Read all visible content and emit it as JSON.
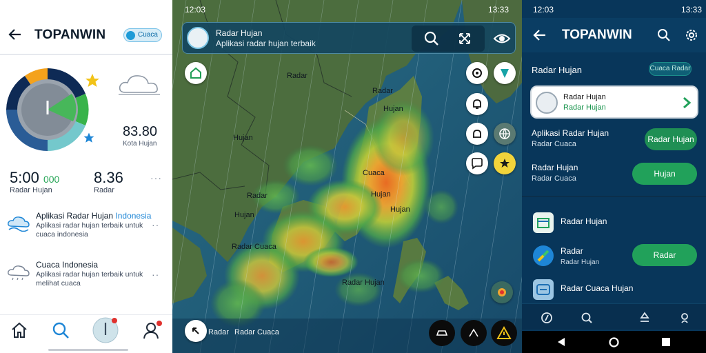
{
  "panel_left": {
    "app_title": "TOPANWIN",
    "chip_label": "Cuaca",
    "big_value": "83.80",
    "big_caption": "Kota Hujan",
    "stat1": {
      "value": "5:00",
      "accent": "000",
      "label": "Radar Hujan"
    },
    "stat2": {
      "value": "8.36",
      "label": "Radar"
    },
    "list": [
      {
        "title": "Aplikasi Radar Hujan",
        "title_accent": "Indonesia",
        "desc": "Aplikasi radar hujan terbaik untuk cuaca indonesia"
      },
      {
        "title": "Cuaca Indonesia",
        "title_accent": "",
        "desc": "Aplikasi radar hujan terbaik untuk melihat cuaca"
      }
    ],
    "icons": [
      "back-arrow-icon",
      "gauge-icon",
      "star-icon",
      "cloud-icon",
      "home-icon",
      "search-icon",
      "compass-icon",
      "profile-icon"
    ]
  },
  "panel_map": {
    "status_time": "12:03",
    "status_right": "13:33",
    "search_title": "Radar Hujan",
    "search_subtitle": "Aplikasi radar hujan terbaik",
    "labels": [
      "Radar",
      "Radar",
      "Hujan",
      "Hujan",
      "Cuaca",
      "Radar",
      "Hujan",
      "Hujan",
      "Hujan",
      "Radar Cuaca",
      "Radar Hujan",
      "Radar",
      "Radar Cuaca"
    ],
    "rain_legend": [
      "heavy-rain",
      "moderate-rain",
      "light-rain"
    ],
    "icons": [
      "avatar-icon",
      "search-icon",
      "expand-icon",
      "eye-icon",
      "map-pin-icon",
      "navigation-icon",
      "layers-icon",
      "bell-icon",
      "alarm-icon",
      "chat-icon",
      "globe-icon",
      "star-badge-icon",
      "location-icon",
      "back-icon"
    ]
  },
  "panel_right": {
    "status_time": "12:03",
    "status_right": "13:33",
    "app_title": "TOPANWIN",
    "section_title": "Radar Hujan",
    "section_pill": "Cuaca Radar",
    "card_title": "Radar Hujan",
    "card_subtitle": "Radar Hujan",
    "rows": [
      {
        "title": "Aplikasi Radar Hujan",
        "subtitle": "Radar Cuaca",
        "button": "Radar Hujan"
      },
      {
        "title": "Radar Hujan",
        "subtitle": "Radar Cuaca",
        "button": "Hujan"
      }
    ],
    "list": [
      {
        "title": "Radar Hujan",
        "subtitle": ""
      },
      {
        "title": "Radar",
        "subtitle": "Radar Hujan",
        "button": "Radar"
      },
      {
        "title": "Radar Cuaca Hujan",
        "subtitle": ""
      }
    ],
    "colors": {
      "accent_green": "#21a15a",
      "panel_bg": "#08365a"
    }
  }
}
